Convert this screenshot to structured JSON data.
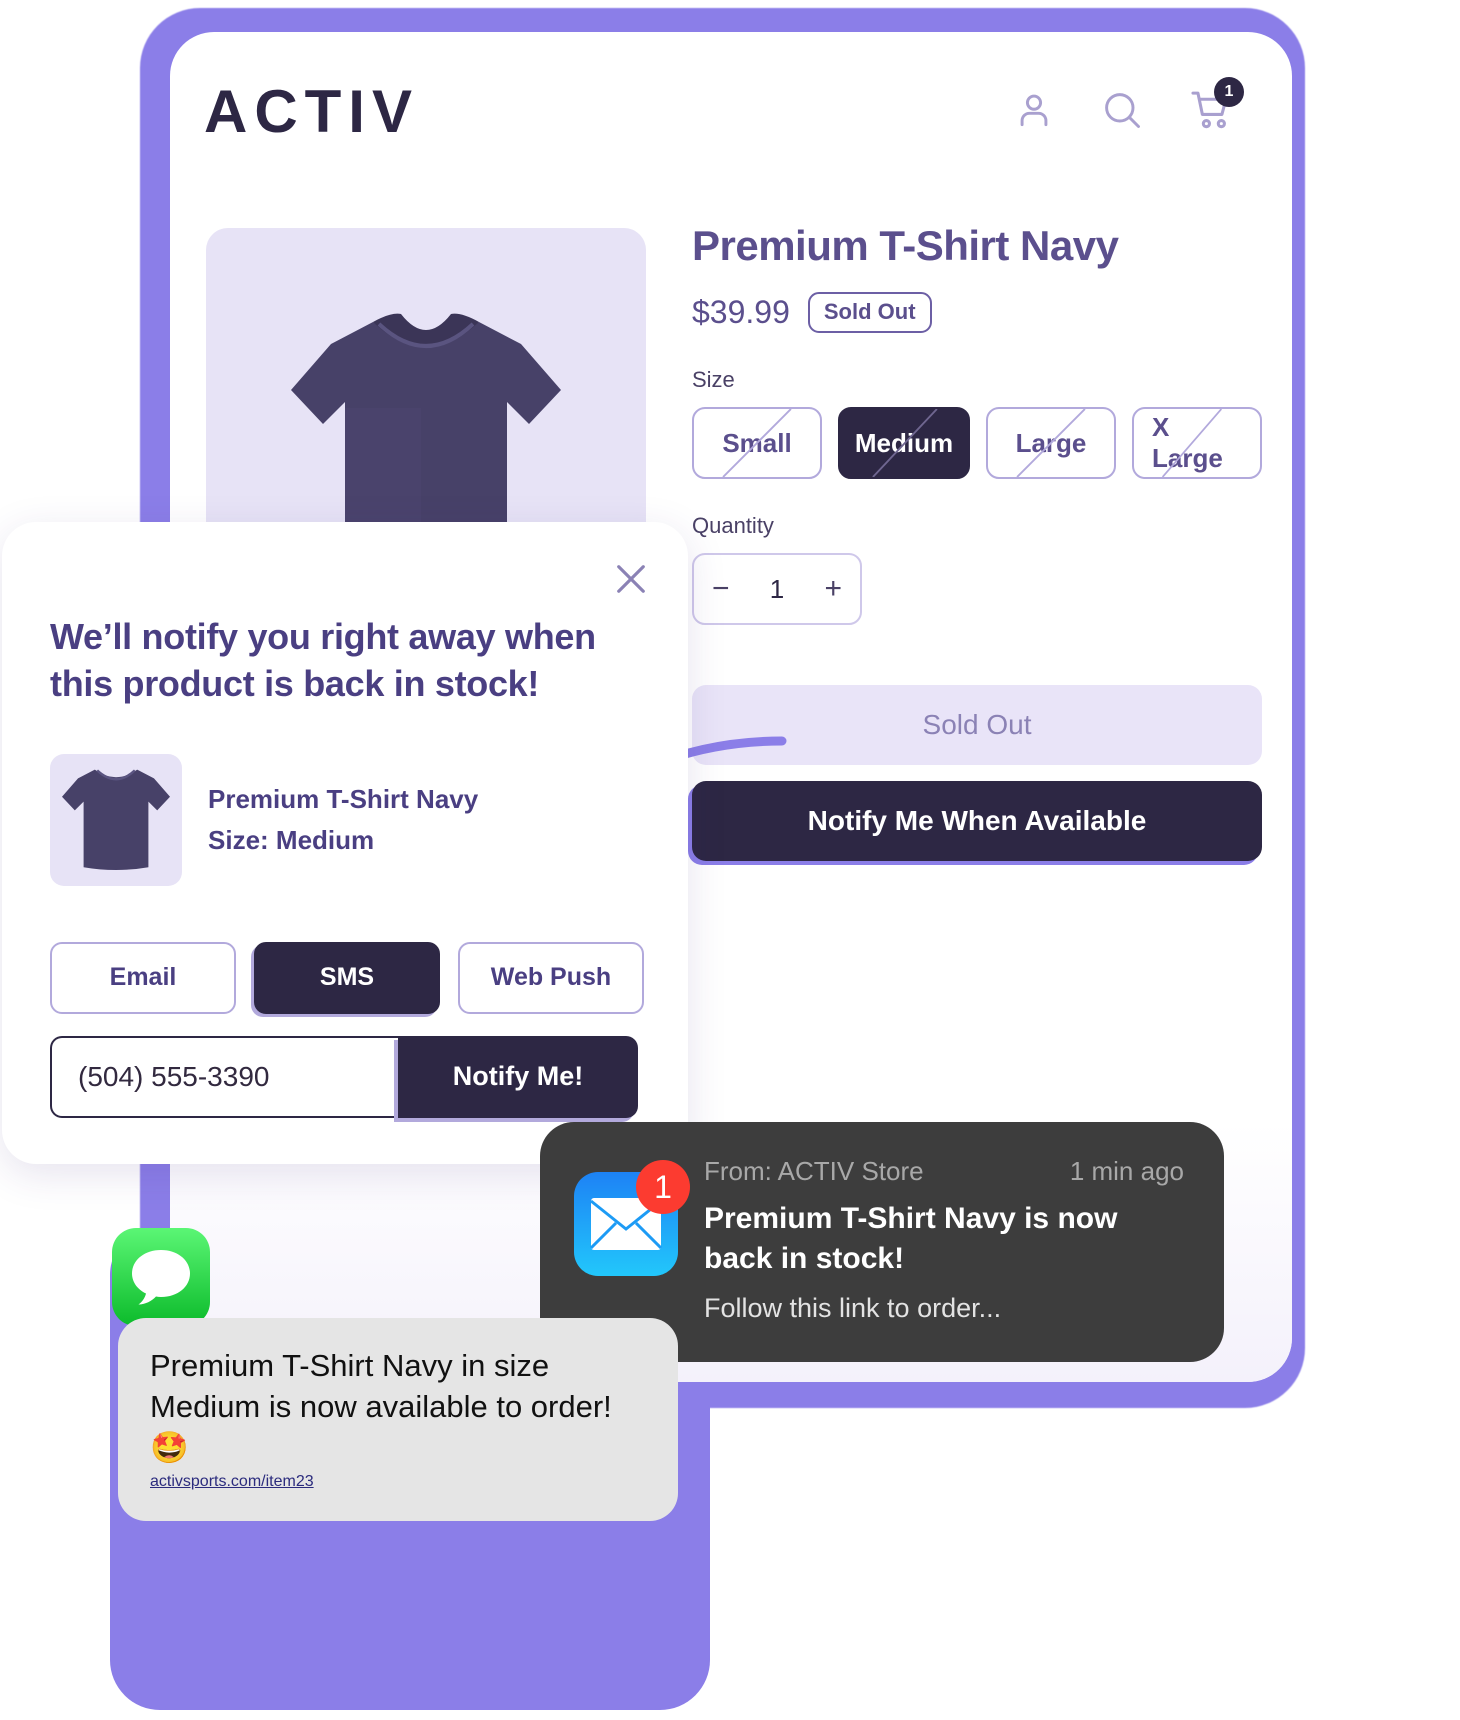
{
  "store": {
    "logo_text": "ACTIV",
    "header_icons": [
      {
        "name": "account-icon",
        "label": "Account"
      },
      {
        "name": "search-icon",
        "label": "Search"
      },
      {
        "name": "cart-icon",
        "label": "Cart"
      }
    ],
    "cart_count": "1"
  },
  "product": {
    "title": "Premium T-Shirt Navy",
    "price": "$39.99",
    "stock_badge": "Sold Out",
    "size_label": "Size",
    "sizes": [
      {
        "label": "Small",
        "selected": false,
        "unavailable": true
      },
      {
        "label": "Medium",
        "selected": true,
        "unavailable": true
      },
      {
        "label": "Large",
        "selected": false,
        "unavailable": true
      },
      {
        "label": "X Large",
        "selected": false,
        "unavailable": true
      }
    ],
    "quantity_label": "Quantity",
    "quantity_value": "1",
    "quantity_decrement": "−",
    "quantity_increment": "+",
    "sold_out_button": "Sold Out",
    "notify_button": "Notify Me When Available"
  },
  "modal": {
    "close_label": "×",
    "headline": "We’ll notify you right away when this product is back in stock!",
    "product_name": "Premium T-Shirt Navy",
    "product_size": "Size: Medium",
    "channels": [
      {
        "label": "Email",
        "active": false
      },
      {
        "label": "SMS",
        "active": true
      },
      {
        "label": "Web Push",
        "active": false
      }
    ],
    "phone_value": "(504) 555-3390",
    "phone_placeholder": "(504) 555-3390",
    "submit_label": "Notify Me!"
  },
  "email_notification": {
    "from": "From: ACTIV Store",
    "time": "1 min ago",
    "badge": "1",
    "title": "Premium T-Shirt Navy is now back in stock!",
    "subtitle": "Follow this link to order..."
  },
  "sms_notification": {
    "text": "Premium T-Shirt Navy in size Medium is now available to order! 🤩",
    "link": "activsports.com/item23"
  },
  "colors": {
    "brand_dark": "#2d2744",
    "brand_purple": "#5b4f8d",
    "accent_violet": "#8b7ee8",
    "lavender_bg": "#e7e3f6",
    "badge_red": "#fc3b30"
  }
}
